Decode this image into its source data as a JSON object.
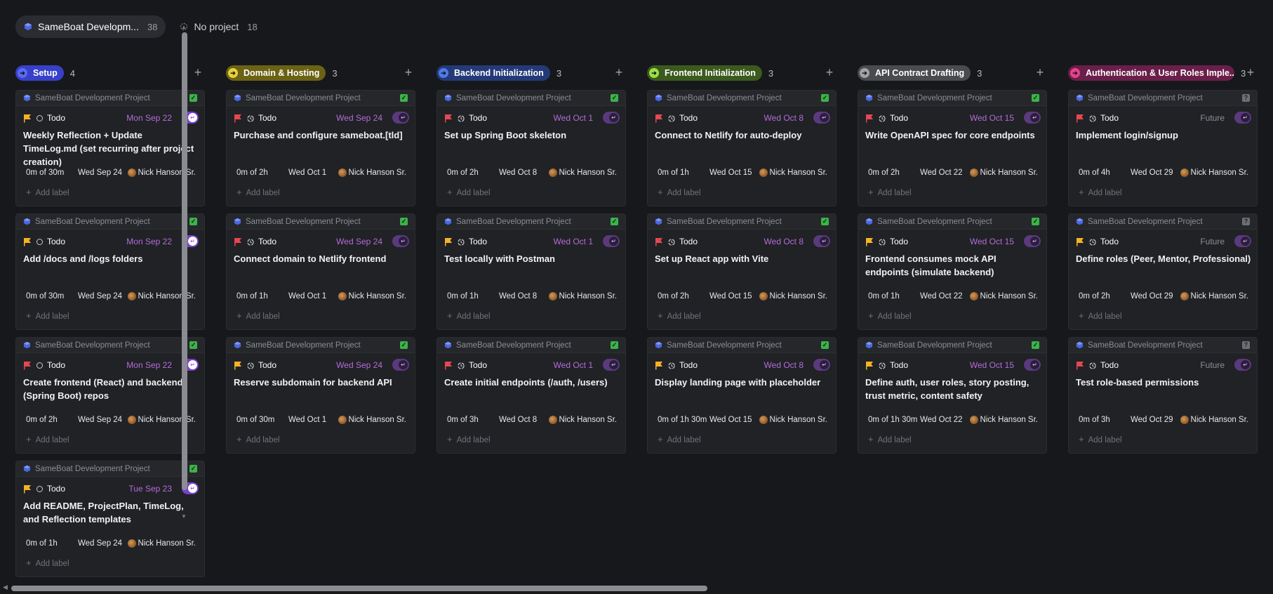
{
  "filters": [
    {
      "label": "SameBoat Developm...",
      "count": "38",
      "active": true
    },
    {
      "label": "No project",
      "count": "18",
      "active": false
    }
  ],
  "columns": [
    {
      "name": "Setup",
      "count": "4",
      "color": "#3740c9",
      "dot": "#5a6bf2",
      "cards": [
        {
          "project": "SameBoat Development Project",
          "priority": "yellow",
          "status_icon": "circle",
          "status": "Todo",
          "due": "Mon Sep 22",
          "toggle_on": true,
          "check": "green",
          "title": "Weekly Reflection + Update TimeLog.md (set recurring after project creation)",
          "estimate": "0m of 30m",
          "start": "Wed Sep 24",
          "owner": "Nick Hanson Sr.",
          "add_label": "Add label"
        },
        {
          "project": "SameBoat Development Project",
          "priority": "yellow",
          "status_icon": "circle",
          "status": "Todo",
          "due": "Mon Sep 22",
          "toggle_on": true,
          "check": "green",
          "title": "Add /docs and /logs folders",
          "estimate": "0m of 30m",
          "start": "Wed Sep 24",
          "owner": "Nick Hanson Sr.",
          "add_label": "Add label"
        },
        {
          "project": "SameBoat Development Project",
          "priority": "red",
          "status_icon": "circle",
          "status": "Todo",
          "due": "Mon Sep 22",
          "toggle_on": true,
          "check": "green",
          "title": "Create frontend (React) and backend (Spring Boot) repos",
          "estimate": "0m of 2h",
          "start": "Wed Sep 24",
          "owner": "Nick Hanson Sr.",
          "add_label": "Add label"
        },
        {
          "project": "SameBoat Development Project",
          "priority": "yellow",
          "status_icon": "circle",
          "status": "Todo",
          "due": "Tue Sep 23",
          "toggle_on": true,
          "check": "green",
          "title": "Add README, ProjectPlan, TimeLog, and Reflection templates",
          "estimate": "0m of 1h",
          "start": "Wed Sep 24",
          "owner": "Nick Hanson Sr.",
          "add_label": "Add label"
        }
      ]
    },
    {
      "name": "Domain & Hosting",
      "count": "3",
      "color": "#6b6214",
      "dot": "#e5d13a",
      "cards": [
        {
          "project": "SameBoat Development Project",
          "priority": "red",
          "status_icon": "clock",
          "status": "Todo",
          "due": "Wed Sep 24",
          "toggle_on": false,
          "check": "green",
          "title": "Purchase and configure sameboat.[tld]",
          "estimate": "0m of 2h",
          "start": "Wed Oct 1",
          "owner": "Nick Hanson Sr.",
          "add_label": "Add label"
        },
        {
          "project": "SameBoat Development Project",
          "priority": "red",
          "status_icon": "clock",
          "status": "Todo",
          "due": "Wed Sep 24",
          "toggle_on": false,
          "check": "green",
          "title": "Connect domain to Netlify frontend",
          "estimate": "0m of 1h",
          "start": "Wed Oct 1",
          "owner": "Nick Hanson Sr.",
          "add_label": "Add label"
        },
        {
          "project": "SameBoat Development Project",
          "priority": "yellow",
          "status_icon": "clock",
          "status": "Todo",
          "due": "Wed Sep 24",
          "toggle_on": false,
          "check": "green",
          "title": "Reserve subdomain for backend API",
          "estimate": "0m of 30m",
          "start": "Wed Oct 1",
          "owner": "Nick Hanson Sr.",
          "add_label": "Add label"
        }
      ]
    },
    {
      "name": "Backend Initialization",
      "count": "3",
      "color": "#243a78",
      "dot": "#4f7ae8",
      "cards": [
        {
          "project": "SameBoat Development Project",
          "priority": "red",
          "status_icon": "clock",
          "status": "Todo",
          "due": "Wed Oct 1",
          "toggle_on": false,
          "check": "green",
          "title": "Set up Spring Boot skeleton",
          "estimate": "0m of 2h",
          "start": "Wed Oct 8",
          "owner": "Nick Hanson Sr.",
          "add_label": "Add label"
        },
        {
          "project": "SameBoat Development Project",
          "priority": "yellow",
          "status_icon": "clock",
          "status": "Todo",
          "due": "Wed Oct 1",
          "toggle_on": false,
          "check": "green",
          "title": "Test locally with Postman",
          "estimate": "0m of 1h",
          "start": "Wed Oct 8",
          "owner": "Nick Hanson Sr.",
          "add_label": "Add label"
        },
        {
          "project": "SameBoat Development Project",
          "priority": "red",
          "status_icon": "clock",
          "status": "Todo",
          "due": "Wed Oct 1",
          "toggle_on": false,
          "check": "green",
          "title": "Create initial endpoints (/auth, /users)",
          "estimate": "0m of 3h",
          "start": "Wed Oct 8",
          "owner": "Nick Hanson Sr.",
          "add_label": "Add label"
        }
      ]
    },
    {
      "name": "Frontend Initialization",
      "count": "3",
      "color": "#3b5a1e",
      "dot": "#9be048",
      "cards": [
        {
          "project": "SameBoat Development Project",
          "priority": "red",
          "status_icon": "clock",
          "status": "Todo",
          "due": "Wed Oct 8",
          "toggle_on": false,
          "check": "green",
          "title": "Connect to Netlify for auto-deploy",
          "estimate": "0m of 1h",
          "start": "Wed Oct 15",
          "owner": "Nick Hanson Sr.",
          "add_label": "Add label"
        },
        {
          "project": "SameBoat Development Project",
          "priority": "red",
          "status_icon": "clock",
          "status": "Todo",
          "due": "Wed Oct 8",
          "toggle_on": false,
          "check": "green",
          "title": "Set up React app with Vite",
          "estimate": "0m of 2h",
          "start": "Wed Oct 15",
          "owner": "Nick Hanson Sr.",
          "add_label": "Add label"
        },
        {
          "project": "SameBoat Development Project",
          "priority": "yellow",
          "status_icon": "clock",
          "status": "Todo",
          "due": "Wed Oct 8",
          "toggle_on": false,
          "check": "green",
          "title": "Display landing page with placeholder",
          "estimate": "0m of 1h 30m",
          "start": "Wed Oct 15",
          "owner": "Nick Hanson Sr.",
          "add_label": "Add label"
        }
      ]
    },
    {
      "name": "API Contract Drafting",
      "count": "3",
      "color": "#4a4b4f",
      "dot": "#a0a3a8",
      "cards": [
        {
          "project": "SameBoat Development Project",
          "priority": "red",
          "status_icon": "clock",
          "status": "Todo",
          "due": "Wed Oct 15",
          "toggle_on": false,
          "check": "green",
          "title": "Write OpenAPI spec for core endpoints",
          "estimate": "0m of 2h",
          "start": "Wed Oct 22",
          "owner": "Nick Hanson Sr.",
          "add_label": "Add label"
        },
        {
          "project": "SameBoat Development Project",
          "priority": "yellow",
          "status_icon": "clock",
          "status": "Todo",
          "due": "Wed Oct 15",
          "toggle_on": false,
          "check": "green",
          "title": "Frontend consumes mock API endpoints (simulate backend)",
          "estimate": "0m of 1h",
          "start": "Wed Oct 22",
          "owner": "Nick Hanson Sr.",
          "add_label": "Add label"
        },
        {
          "project": "SameBoat Development Project",
          "priority": "yellow",
          "status_icon": "clock",
          "status": "Todo",
          "due": "Wed Oct 15",
          "toggle_on": false,
          "check": "green",
          "title": "Define auth, user roles, story posting, trust metric, content safety",
          "estimate": "0m of 1h 30m",
          "start": "Wed Oct 22",
          "owner": "Nick Hanson Sr.",
          "add_label": "Add label"
        }
      ]
    },
    {
      "name": "Authentication & User Roles Imple...",
      "count": "3",
      "color": "#6a1f4a",
      "dot": "#e8418f",
      "cards": [
        {
          "project": "SameBoat Development Project",
          "priority": "red",
          "status_icon": "clock",
          "status": "Todo",
          "due": "Future",
          "toggle_on": false,
          "check": "gray",
          "title": "Implement login/signup",
          "estimate": "0m of 4h",
          "start": "Wed Oct 29",
          "owner": "Nick Hanson Sr.",
          "add_label": "Add label"
        },
        {
          "project": "SameBoat Development Project",
          "priority": "yellow",
          "status_icon": "clock",
          "status": "Todo",
          "due": "Future",
          "toggle_on": false,
          "check": "gray",
          "title": "Define roles (Peer, Mentor, Professional)",
          "estimate": "0m of 2h",
          "start": "Wed Oct 29",
          "owner": "Nick Hanson Sr.",
          "add_label": "Add label"
        },
        {
          "project": "SameBoat Development Project",
          "priority": "red",
          "status_icon": "clock",
          "status": "Todo",
          "due": "Future",
          "toggle_on": false,
          "check": "gray",
          "title": "Test role-based permissions",
          "estimate": "0m of 3h",
          "start": "Wed Oct 29",
          "owner": "Nick Hanson Sr.",
          "add_label": "Add label"
        }
      ]
    }
  ],
  "colors": {
    "flag_red": "#e5484d",
    "flag_yellow": "#f5b324",
    "due_purple": "#b66bd9",
    "toggle_purple": "#7b3fcf"
  }
}
